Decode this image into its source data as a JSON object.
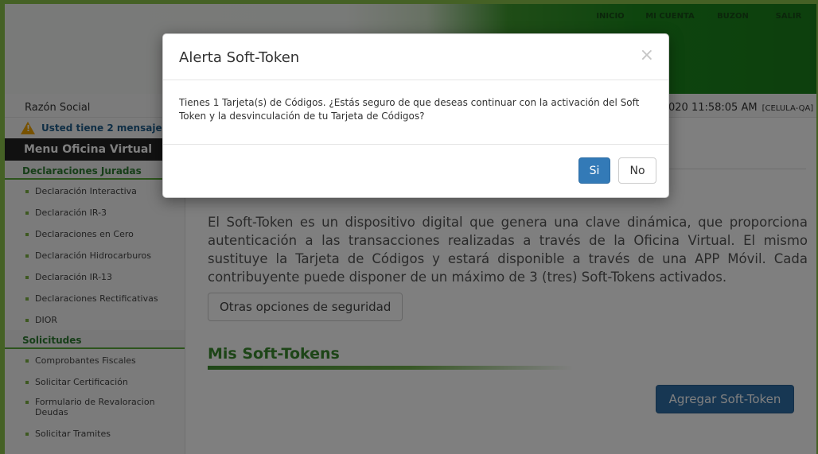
{
  "topnav": {
    "inicio": "INICIO",
    "mi_cuenta": "MI CUENTA",
    "buzon": "BUZON",
    "salir": "SALIR"
  },
  "infobar": {
    "razon_social": "Razón Social",
    "datetime": "020 11:58:05 AM",
    "celula": "[CELULA-QA]"
  },
  "sidebar": {
    "alert": "Usted tiene 2 mensaje(",
    "menu_title": "Menu Oficina Virtual",
    "sections": [
      {
        "title": "Declaraciones Juradas",
        "items": [
          "Declaración Interactiva",
          "Declaración IR-3",
          "Declaraciones en Cero",
          "Declaración Hidrocarburos",
          "Declaración IR-13",
          "Declaraciones Rectificativas",
          "DIOR"
        ]
      },
      {
        "title": "Solicitudes",
        "items": [
          "Comprobantes Fiscales",
          "Solicitar Certificación",
          "Formulario de Revaloracion Deudas",
          "Solicitar Tramites"
        ]
      }
    ]
  },
  "main": {
    "description": "El Soft-Token es un dispositivo digital que genera una clave dinámica, que proporciona autenticación a las transacciones realizadas a través de la Oficina Virtual. El mismo sustituye la Tarjeta de Códigos y estará disponible a través de una APP Móvil. Cada contribuyente puede disponer de un máximo de 3 (tres) Soft-Tokens activados.",
    "otras_opciones": "Otras opciones de seguridad",
    "section_title": "Mis Soft-Tokens",
    "agregar": "Agregar Soft-Token"
  },
  "modal": {
    "title": "Alerta Soft-Token",
    "close": "×",
    "body": "Tienes 1 Tarjeta(s) de Códigos. ¿Estás seguro de que deseas continuar con la activación del Soft Token y la desvinculación de tu Tarjeta de Códigos?",
    "si": "Si",
    "no": "No"
  },
  "colors": {
    "accent_green": "#3b8a2e",
    "primary_blue": "#337ab7"
  }
}
